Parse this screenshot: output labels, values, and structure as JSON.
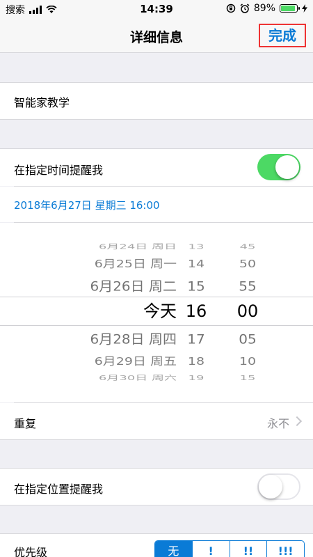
{
  "status_bar": {
    "carrier": "搜索",
    "time": "14:39",
    "battery_percent": "89%",
    "battery_level": 0.89,
    "icons": [
      "signal-icon",
      "wifi-icon",
      "rotation-lock-icon",
      "alarm-icon",
      "battery-icon",
      "charging-icon"
    ]
  },
  "nav": {
    "title": "详细信息",
    "done_label": "完成"
  },
  "task": {
    "title": "智能家教学"
  },
  "remind_time": {
    "label": "在指定时间提醒我",
    "enabled": true,
    "datetime_text": "2018年6月27日 星期三 16:00"
  },
  "picker": {
    "rows": [
      {
        "date": "6月24日 周日",
        "hour": "13",
        "minute": "45"
      },
      {
        "date": "6月25日 周一",
        "hour": "14",
        "minute": "50"
      },
      {
        "date": "6月26日 周二",
        "hour": "15",
        "minute": "55"
      },
      {
        "date": "今天",
        "hour": "16",
        "minute": "00"
      },
      {
        "date": "6月28日 周四",
        "hour": "17",
        "minute": "05"
      },
      {
        "date": "6月29日 周五",
        "hour": "18",
        "minute": "10"
      },
      {
        "date": "6月30日 周六",
        "hour": "19",
        "minute": "15"
      }
    ]
  },
  "repeat": {
    "label": "重复",
    "value": "永不"
  },
  "remind_location": {
    "label": "在指定位置提醒我",
    "enabled": false
  },
  "priority": {
    "label": "优先级",
    "options": [
      "无",
      "!",
      "!!",
      "!!!"
    ],
    "selected": "无"
  },
  "colors": {
    "accent": "#0a7bd6",
    "toggle_on": "#4cd964",
    "highlight_border": "#e33333"
  }
}
